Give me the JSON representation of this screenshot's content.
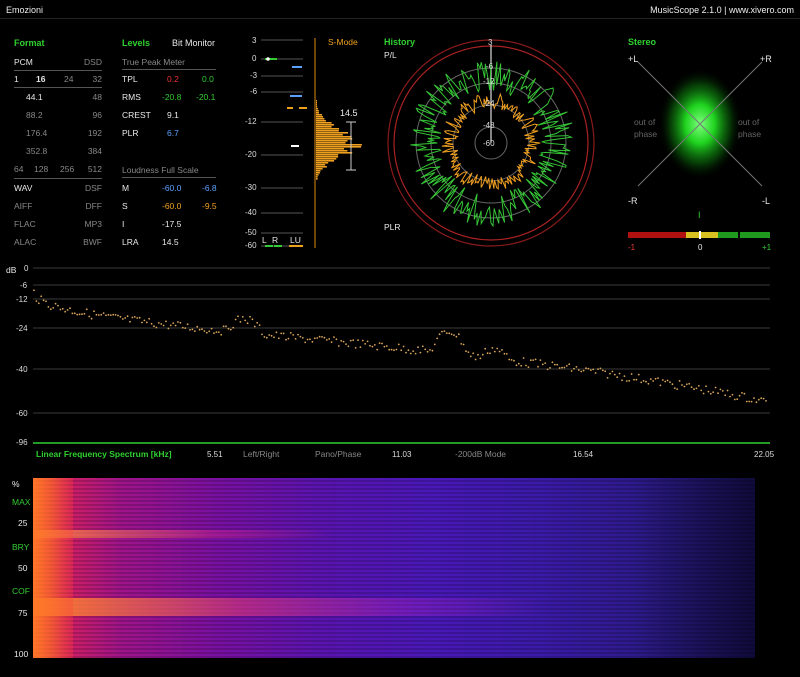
{
  "window": {
    "title": "Emozioni",
    "app_version": "MusicScope 2.1.0 | www.xivero.com"
  },
  "format": {
    "heading": "Format",
    "pcm_label": "PCM",
    "dsd_label": "DSD",
    "bitdepth_row": [
      "1",
      "16",
      "24",
      "32"
    ],
    "rate_rows": [
      {
        "pcm": "44.1",
        "dsd": "48"
      },
      {
        "pcm": "88.2",
        "dsd": "96"
      },
      {
        "pcm": "176.4",
        "dsd": "192"
      },
      {
        "pcm": "352.8",
        "dsd": "384"
      }
    ],
    "dsd_row": [
      "64",
      "128",
      "256",
      "512"
    ],
    "containers": [
      {
        "left": "WAV",
        "right": "DSF"
      },
      {
        "left": "AIFF",
        "right": "DFF"
      },
      {
        "left": "FLAC",
        "right": "MP3"
      },
      {
        "left": "ALAC",
        "right": "BWF"
      }
    ]
  },
  "levels": {
    "heading": "Levels",
    "bit_monitor": "Bit Monitor",
    "true_peak_title": "True Peak Meter",
    "rows": [
      {
        "label": "TPL",
        "left": "0.2",
        "right": "0.0"
      },
      {
        "label": "RMS",
        "left": "-20.8",
        "right": "-20.1"
      },
      {
        "label": "CREST",
        "left": "9.1",
        "right": ""
      },
      {
        "label": "PLR",
        "left": "6.7",
        "right": ""
      }
    ],
    "loudness_title": "Loudness Full Scale",
    "loudness_rows": [
      {
        "label": "M",
        "left": "-60.0",
        "right": "-6.8"
      },
      {
        "label": "S",
        "left": "-60.0",
        "right": "-9.5"
      },
      {
        "label": "I",
        "left": "-17.5",
        "right": ""
      },
      {
        "label": "LRA",
        "left": "14.5",
        "right": ""
      }
    ]
  },
  "meter": {
    "mode_label": "S-Mode",
    "scale": [
      "3",
      "0",
      "-3",
      "-6",
      "-12",
      "-20",
      "-30",
      "-40",
      "-50",
      "-60"
    ],
    "lra_value": "14.5",
    "channels": [
      "L",
      "R",
      "LU"
    ]
  },
  "history": {
    "heading": "History",
    "pl_label": "P/L",
    "plr_label": "PLR",
    "rings": [
      "3",
      "-6",
      "-12",
      "-24",
      "-48",
      "-60"
    ]
  },
  "stereo": {
    "heading": "Stereo",
    "plus_l": "+L",
    "plus_r": "+R",
    "minus_r": "-R",
    "minus_l": "-L",
    "oop_left": "out of phase",
    "oop_right": "out of phase",
    "corr_marker": "I",
    "corr_scale": [
      "-1",
      "0",
      "+1"
    ],
    "correlation": 0.1
  },
  "spectrum": {
    "unit": "dB",
    "y_ticks": [
      "0",
      "-6",
      "-12",
      "-24",
      "-40",
      "-60",
      "-96"
    ],
    "title": "Linear Frequency Spectrum [kHz]",
    "x_ticks": [
      "5.51",
      "11.03",
      "16.54",
      "22.05"
    ],
    "options": [
      "Left/Right",
      "Pano/Phase",
      "-200dB Mode"
    ]
  },
  "spectrogram": {
    "y_labels": [
      "%",
      "MAX",
      "25",
      "BRY",
      "50",
      "COF",
      "75",
      "100"
    ]
  },
  "colors": {
    "accent_green": "#2fd02f",
    "red": "#e33",
    "orange": "#f0a020",
    "blue": "#5aa0ff"
  }
}
